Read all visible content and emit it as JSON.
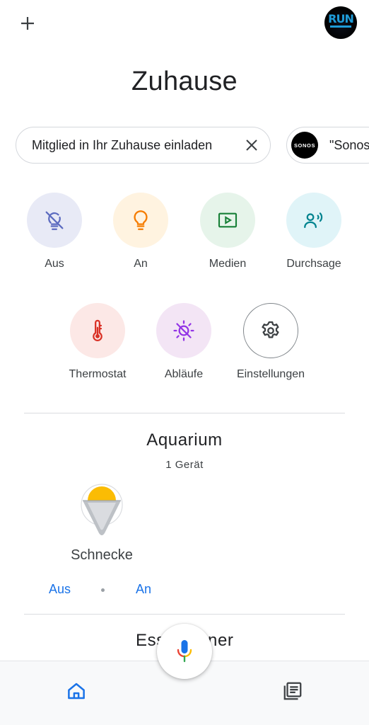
{
  "header": {
    "add_icon": "plus-icon",
    "avatar_text": "RUN"
  },
  "title": "Zuhause",
  "chips": {
    "invite_label": "Mitglied in Ihr Zuhause einladen",
    "invite_close_icon": "close-icon",
    "sonos_logo_text": "SONOS",
    "sonos_label": "\"Sonos"
  },
  "quick_actions": [
    {
      "label": "Aus",
      "icon": "lightbulb-off-icon",
      "bg": "#e8eaf6",
      "fg": "#5c6bc0"
    },
    {
      "label": "An",
      "icon": "lightbulb-icon",
      "bg": "#fff3e0",
      "fg": "#f57c00"
    },
    {
      "label": "Medien",
      "icon": "media-play-icon",
      "bg": "#e6f4ea",
      "fg": "#188038"
    },
    {
      "label": "Durchsage",
      "icon": "broadcast-icon",
      "bg": "#e0f4f8",
      "fg": "#00838f"
    },
    {
      "label": "Thermostat",
      "icon": "thermometer-icon",
      "bg": "#fce8e6",
      "fg": "#d93025"
    },
    {
      "label": "Abläufe",
      "icon": "routines-sun-icon",
      "bg": "#f3e5f5",
      "fg": "#9334e6"
    },
    {
      "label": "Einstellungen",
      "icon": "gear-icon",
      "bg": "#ffffff",
      "fg": "#3c4043"
    }
  ],
  "room": {
    "name": "Aquarium",
    "device_count": "1 Gerät",
    "device": {
      "name": "Schnecke",
      "icon": "light-bulb-device-icon",
      "off_label": "Aus",
      "on_label": "An"
    }
  },
  "next_room": {
    "name": "Esszimmer",
    "visible_left": "Ess",
    "visible_right": "ner",
    "sub_fragment": "2"
  },
  "bottom_nav": {
    "home_icon": "home-icon",
    "mic_icon": "microphone-icon",
    "feed_icon": "feed-list-icon"
  },
  "colors": {
    "accent": "#1a73e8",
    "text": "#202124",
    "secondary_text": "#3c4043",
    "divider": "#dadce0"
  }
}
